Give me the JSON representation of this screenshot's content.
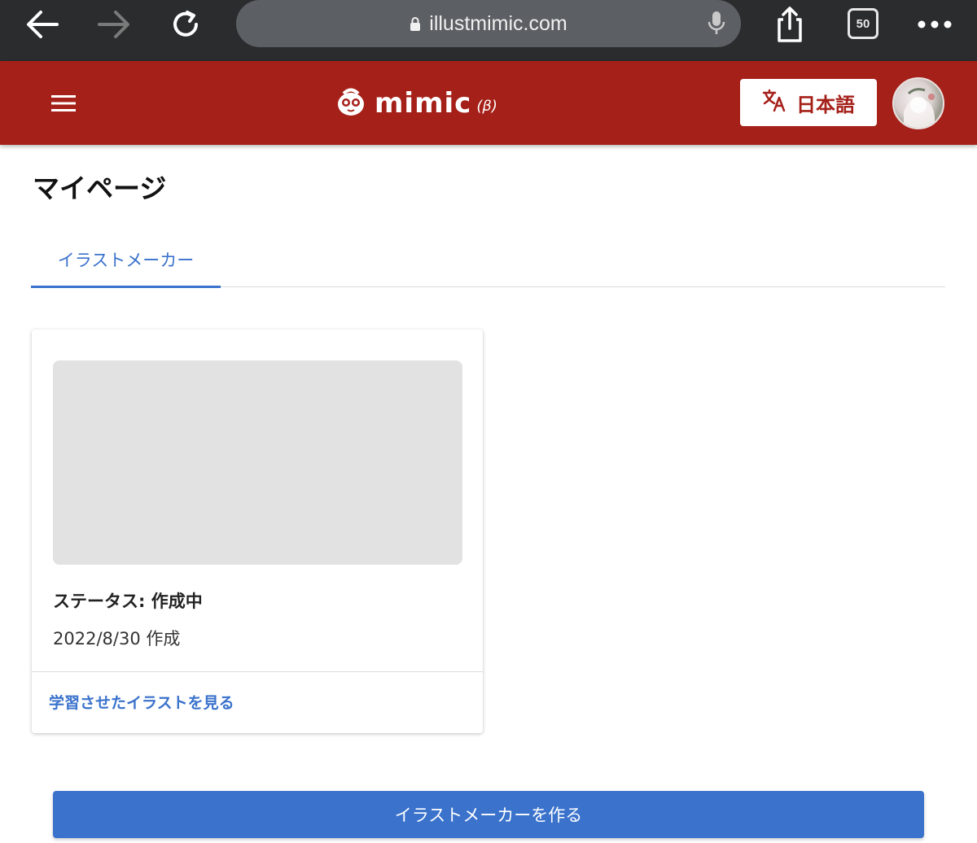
{
  "browser": {
    "url": "illustmimic.com",
    "tab_count": "50",
    "icons": [
      "back-arrow-icon",
      "forward-arrow-icon",
      "reload-icon",
      "lock-icon",
      "microphone-icon",
      "share-icon",
      "tabs-icon",
      "more-icon"
    ]
  },
  "header": {
    "logo_text": "mimic",
    "logo_beta": "(β)",
    "language_label": "日本語",
    "accent_color": "#a52019"
  },
  "page": {
    "title": "マイページ",
    "tabs": [
      {
        "label": "イラストメーカー",
        "active": true
      }
    ]
  },
  "cards": [
    {
      "status": "ステータス: 作成中",
      "created": "2022/8/30 作成",
      "link_label": "学習させたイラストを見る"
    }
  ],
  "actions": {
    "create_label": "イラストメーカーを作る",
    "button_color": "#3a72cc"
  }
}
